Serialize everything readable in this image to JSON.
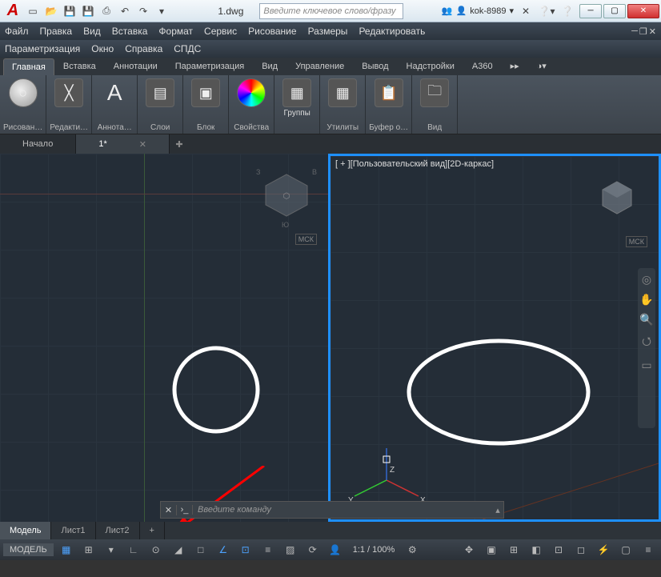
{
  "title": {
    "filename": "1.dwg",
    "search_placeholder": "Введите ключевое слово/фразу",
    "username": "kok-8989"
  },
  "menus1": [
    "Файл",
    "Правка",
    "Вид",
    "Вставка",
    "Формат",
    "Сервис",
    "Рисование",
    "Размеры",
    "Редактировать"
  ],
  "menus2": [
    "Параметризация",
    "Окно",
    "Справка",
    "СПДС"
  ],
  "ribbon_tabs": [
    "Главная",
    "Вставка",
    "Аннотации",
    "Параметризация",
    "Вид",
    "Управление",
    "Вывод",
    "Надстройки",
    "A360",
    "▸▸"
  ],
  "ribbon_panels": {
    "draw": {
      "label": "Рисован…",
      "icon": "○"
    },
    "modify": {
      "label": "Редакти…",
      "icon": "✕"
    },
    "annot": {
      "label": "Аннота…",
      "icon": "A"
    },
    "layers": {
      "label": "Слои",
      "icon": "▤"
    },
    "block": {
      "label": "Блок",
      "icon": "▣"
    },
    "props": {
      "label": "Свойства",
      "icon": "◉"
    },
    "groups": {
      "label": "Группы",
      "icon": "▦"
    },
    "utils": {
      "label": "Утилиты",
      "icon": "▦"
    },
    "clip": {
      "label": "Буфер о…",
      "icon": "📋"
    },
    "view": {
      "label": "Вид",
      "icon": "🗀"
    }
  },
  "file_tabs": {
    "start": "Начало",
    "active": "1*"
  },
  "viewport": {
    "label": "[ + ][Пользовательский вид][2D-каркас]",
    "ucs": "МСК",
    "axes": {
      "x": "X",
      "y": "Y",
      "z": "Z"
    },
    "cube_top": "Ю",
    "cube_left": "З",
    "cube_right": "В"
  },
  "cmdline": {
    "placeholder": "Введите команду"
  },
  "layout_tabs": [
    "Модель",
    "Лист1",
    "Лист2",
    "+"
  ],
  "status": {
    "model": "МОДЕЛЬ",
    "scale": "1:1 / 100%"
  }
}
